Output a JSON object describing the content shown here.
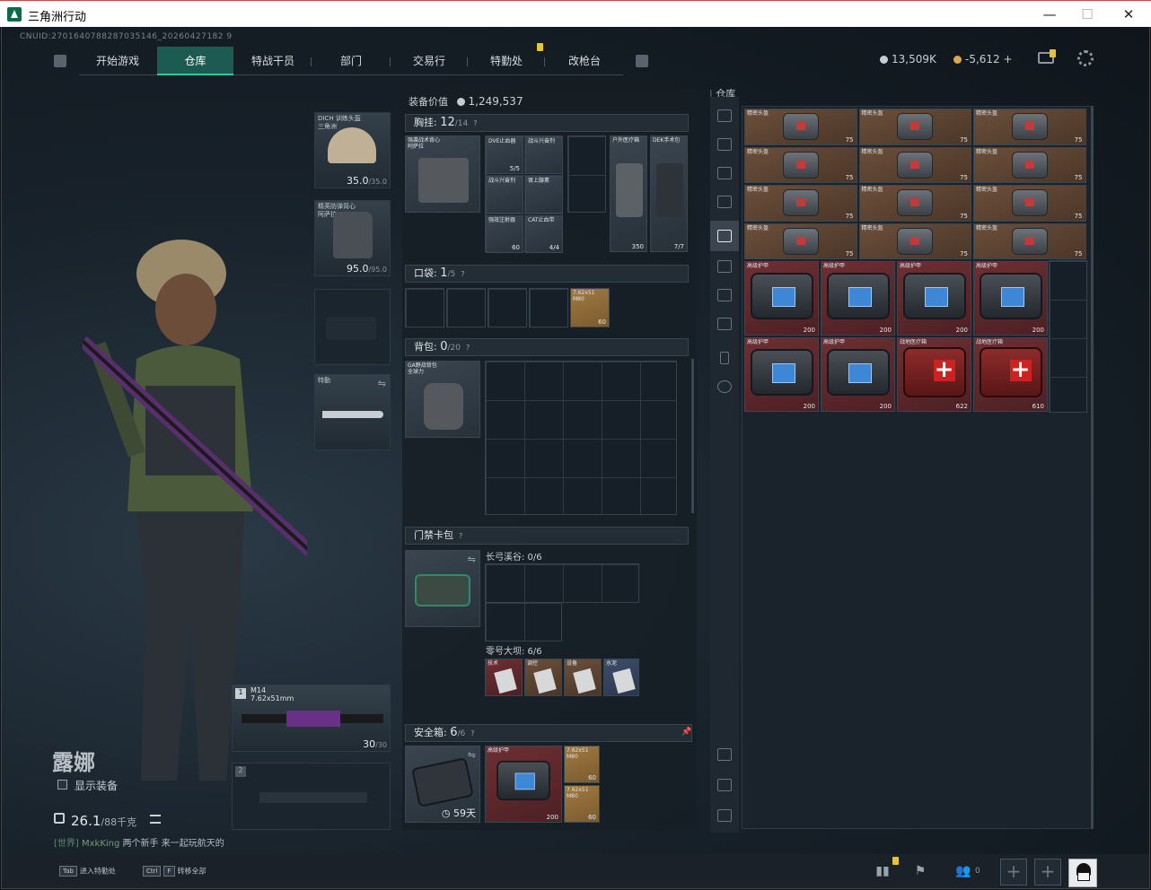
{
  "window": {
    "title": "三角洲行动",
    "minimize": "—",
    "maximize": "☐",
    "close": "✕"
  },
  "uid": "CNUID:2701640788287035146_20260427182 9",
  "nav": {
    "tabs": [
      "开始游戏",
      "仓库",
      "特战干员",
      "部门",
      "交易行",
      "特勤处",
      "改枪台"
    ],
    "active": "仓库"
  },
  "currency": {
    "silver": "13,509K",
    "gold": "-5,612"
  },
  "character": {
    "name": "露娜",
    "show_gear": "显示装备",
    "weight": "26.1",
    "weight_max": "/88千克"
  },
  "chat": {
    "channel": "[世界]",
    "user": "MxkKing",
    "message": "两个新手 来一起玩航天的"
  },
  "gear": {
    "helmet": {
      "label": "DICH 训练头盔\n三角洲",
      "durability": "35.0",
      "max": "/35.0"
    },
    "armor": {
      "label": "精英防弹背心\n阿萨拉",
      "durability": "95.0",
      "max": "/95.0"
    },
    "melee": {
      "label": "特勤"
    },
    "primary": {
      "slot": "1",
      "name": "M14",
      "ammo_type": "7.62x51mm",
      "ammo": "30",
      "ammo_max": "/30"
    },
    "secondary": {
      "slot": "2"
    }
  },
  "loadout": {
    "equip_value_label": "装备价值",
    "equip_value": "1,249,537",
    "chest": {
      "label": "胸挂:",
      "count": "12",
      "max": "/14"
    },
    "chest_rig_name": "强袭战术背心\n阿萨拉",
    "chest_items": [
      {
        "label": "DVE止血器",
        "count": "5/5"
      },
      {
        "label": "战斗兴奋剂",
        "count": ""
      },
      {
        "label": "战斗兴奋剂",
        "count": ""
      },
      {
        "label": "肾上腺素",
        "count": ""
      },
      {
        "label": "强效注射器",
        "count": "60"
      },
      {
        "label": "CAT止血带",
        "count": "4/4"
      },
      {
        "label": "户外医疗箱",
        "count": "350"
      },
      {
        "label": "DEK手术包",
        "count": "7/7"
      }
    ],
    "pocket": {
      "label": "口袋:",
      "count": "1",
      "max": "/5"
    },
    "pocket_item": {
      "label": "7.62x51\nM80",
      "count": "60"
    },
    "backpack": {
      "label": "背包:",
      "count": "0",
      "max": "/20"
    },
    "backpack_name": "GA野战背包\n全球力",
    "keycard": {
      "label": "门禁卡包"
    },
    "key_zone1": "长弓溪谷: 0/6",
    "key_zone2": "零号大坝: 6/6",
    "key_items": [
      "技术",
      "调控",
      "设备",
      "水泥"
    ],
    "safebox": {
      "label": "安全箱:",
      "count": "6",
      "max": "/6",
      "days": "59天"
    },
    "safe_items": [
      {
        "label": "高级护甲",
        "count": "200"
      },
      {
        "label": "7.62x51\nM80",
        "count": "60"
      },
      {
        "label": "7.62x51\nM80",
        "count": "60"
      }
    ]
  },
  "storage": {
    "title": "仓库",
    "helmets": {
      "label": "精密头盔",
      "count": "75"
    },
    "armors": {
      "label": "高级护甲",
      "count": "200"
    },
    "medkits": [
      {
        "label": "战地医疗箱",
        "count": "622"
      },
      {
        "label": "战地医疗箱",
        "count": "610"
      }
    ]
  },
  "bottom": {
    "tab_key": "Tab",
    "tab_label": "进入特勤处",
    "ctrl_key": "Ctrl",
    "f_key": "F",
    "transfer_label": "转移全部",
    "friends_count": "0"
  }
}
